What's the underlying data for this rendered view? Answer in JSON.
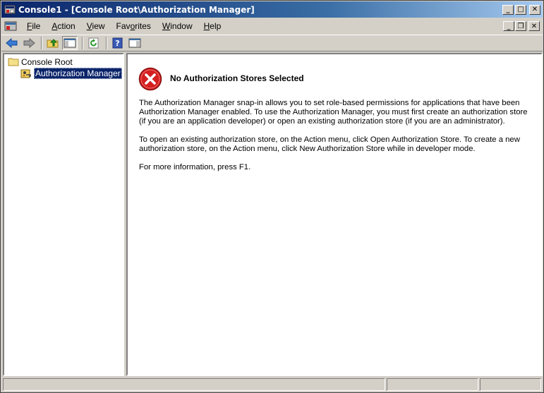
{
  "window": {
    "title": "Console1 - [Console Root\\Authorization Manager]",
    "titlebar_buttons": [
      "minimize",
      "maximize",
      "close"
    ]
  },
  "menubar": {
    "items": [
      {
        "label": "File",
        "underline": "F"
      },
      {
        "label": "Action",
        "underline": "A"
      },
      {
        "label": "View",
        "underline": "V"
      },
      {
        "label": "Favorites",
        "underline": "o"
      },
      {
        "label": "Window",
        "underline": "W"
      },
      {
        "label": "Help",
        "underline": "H"
      }
    ]
  },
  "toolbar": {
    "icons": [
      "back-arrow-icon",
      "forward-arrow-icon",
      "up-folder-icon",
      "show-hide-console-tree-icon",
      "refresh-icon",
      "help-icon",
      "show-hide-action-pane-icon"
    ]
  },
  "tree": {
    "root_label": "Console Root",
    "child_label": "Authorization Manager",
    "selected": "Authorization Manager"
  },
  "content": {
    "heading": "No Authorization Stores Selected",
    "para1_line1": "The Authorization Manager snap-in allows you to set role-based permissions for applications that have been",
    "para1_line2": "Authorization Manager enabled. To use the Authorization Manager, you must first create an authorization store",
    "para1_line3": "(if you are an application developer) or open an existing authorization store (if you are an administrator).",
    "para2_line1": "To open an existing authorization store, on the Action menu, click Open Authorization Store. To create a new",
    "para2_line2": "authorization store, on the Action menu, click New Authorization Store while in developer mode.",
    "para3": "For more information, press F1."
  },
  "colors": {
    "titlebar_start": "#0a246a",
    "titlebar_end": "#a6caf0",
    "face": "#d4d0c8",
    "error_red": "#d42020",
    "selection": "#0a246a"
  }
}
